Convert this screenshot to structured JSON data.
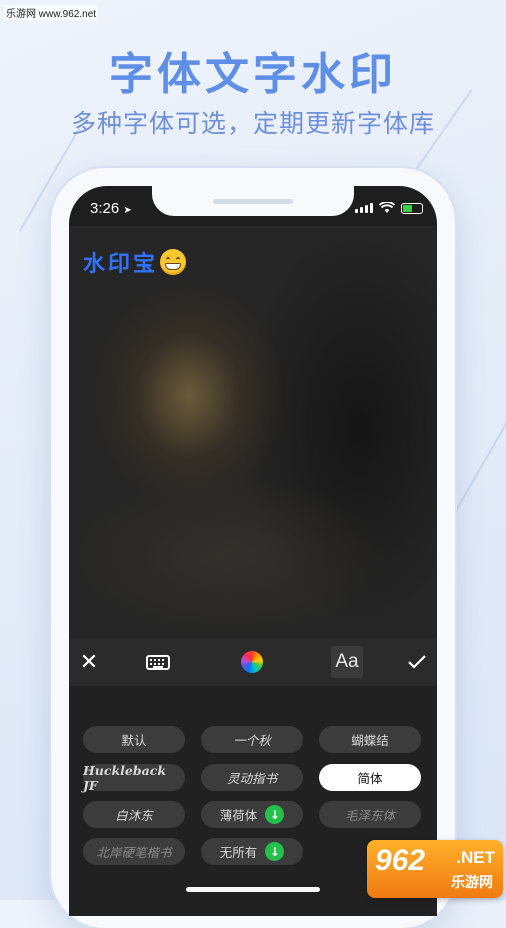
{
  "site_watermark": "乐游网 www.962.net",
  "promo": {
    "headline": "字体文字水印",
    "subheadline": "多种字体可选，定期更新字体库"
  },
  "status_bar": {
    "time": "3:26",
    "location_icon": "location-arrow-icon",
    "signal_icon": "cellular-signal-icon",
    "wifi_icon": "wifi-icon",
    "battery_icon": "battery-charging-icon"
  },
  "watermark_overlay": {
    "text": "水印宝",
    "emoji": "grinning-face-icon",
    "color": "#2f73ff"
  },
  "toolbar": {
    "close_icon": "close-icon",
    "keyboard_icon": "keyboard-icon",
    "color_icon": "color-wheel-icon",
    "font_label": "Aa",
    "confirm_icon": "checkmark-icon"
  },
  "fonts": [
    {
      "label": "默认"
    },
    {
      "label": "一个秋"
    },
    {
      "label": "蝴蝶结"
    },
    {
      "label": "Huckleback JF"
    },
    {
      "label": "灵动指书"
    },
    {
      "label": "简体",
      "selected": true
    },
    {
      "label": "白沐东"
    },
    {
      "label": "薄荷体",
      "download": true
    },
    {
      "label": "毛泽东体"
    },
    {
      "label": "北岸硬笔楷书"
    },
    {
      "label": "无所有",
      "download": true
    }
  ],
  "badge": {
    "number": "962",
    "suffix": ".NET",
    "name": "乐游网"
  },
  "colors": {
    "accent": "#5f8ee6",
    "selected_font_bg": "#ffffff",
    "download_green": "#22c24a",
    "badge_orange": "#f59a1f"
  }
}
